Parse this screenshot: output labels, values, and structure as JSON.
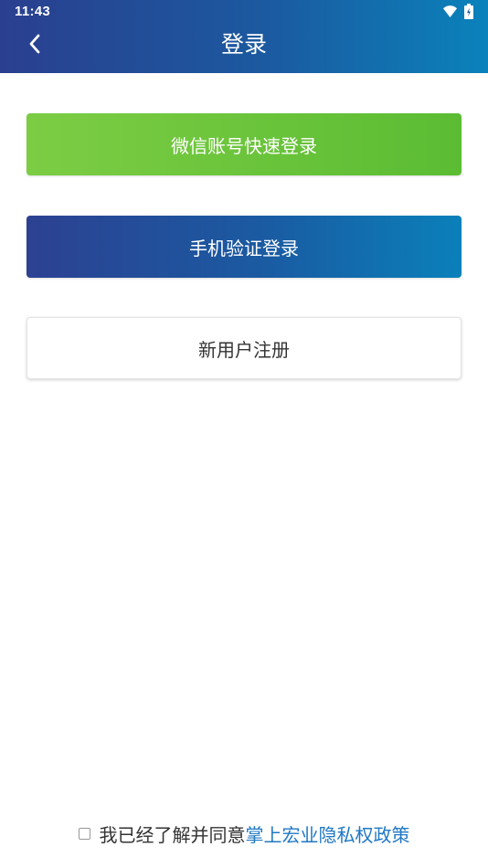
{
  "status_bar": {
    "time": "11:43"
  },
  "header": {
    "title": "登录"
  },
  "buttons": {
    "wechat_login": "微信账号快速登录",
    "phone_login": "手机验证登录",
    "register": "新用户注册"
  },
  "agreement": {
    "text": "我已经了解并同意",
    "policy_link": "掌上宏业隐私权政策"
  },
  "colors": {
    "header_gradient_start": "#2a3f8f",
    "header_gradient_end": "#0a82bb",
    "wechat_green": "#6cc63c",
    "link_blue": "#1f78c4"
  },
  "icons": [
    "back-arrow-icon",
    "wifi-icon",
    "battery-icon"
  ]
}
